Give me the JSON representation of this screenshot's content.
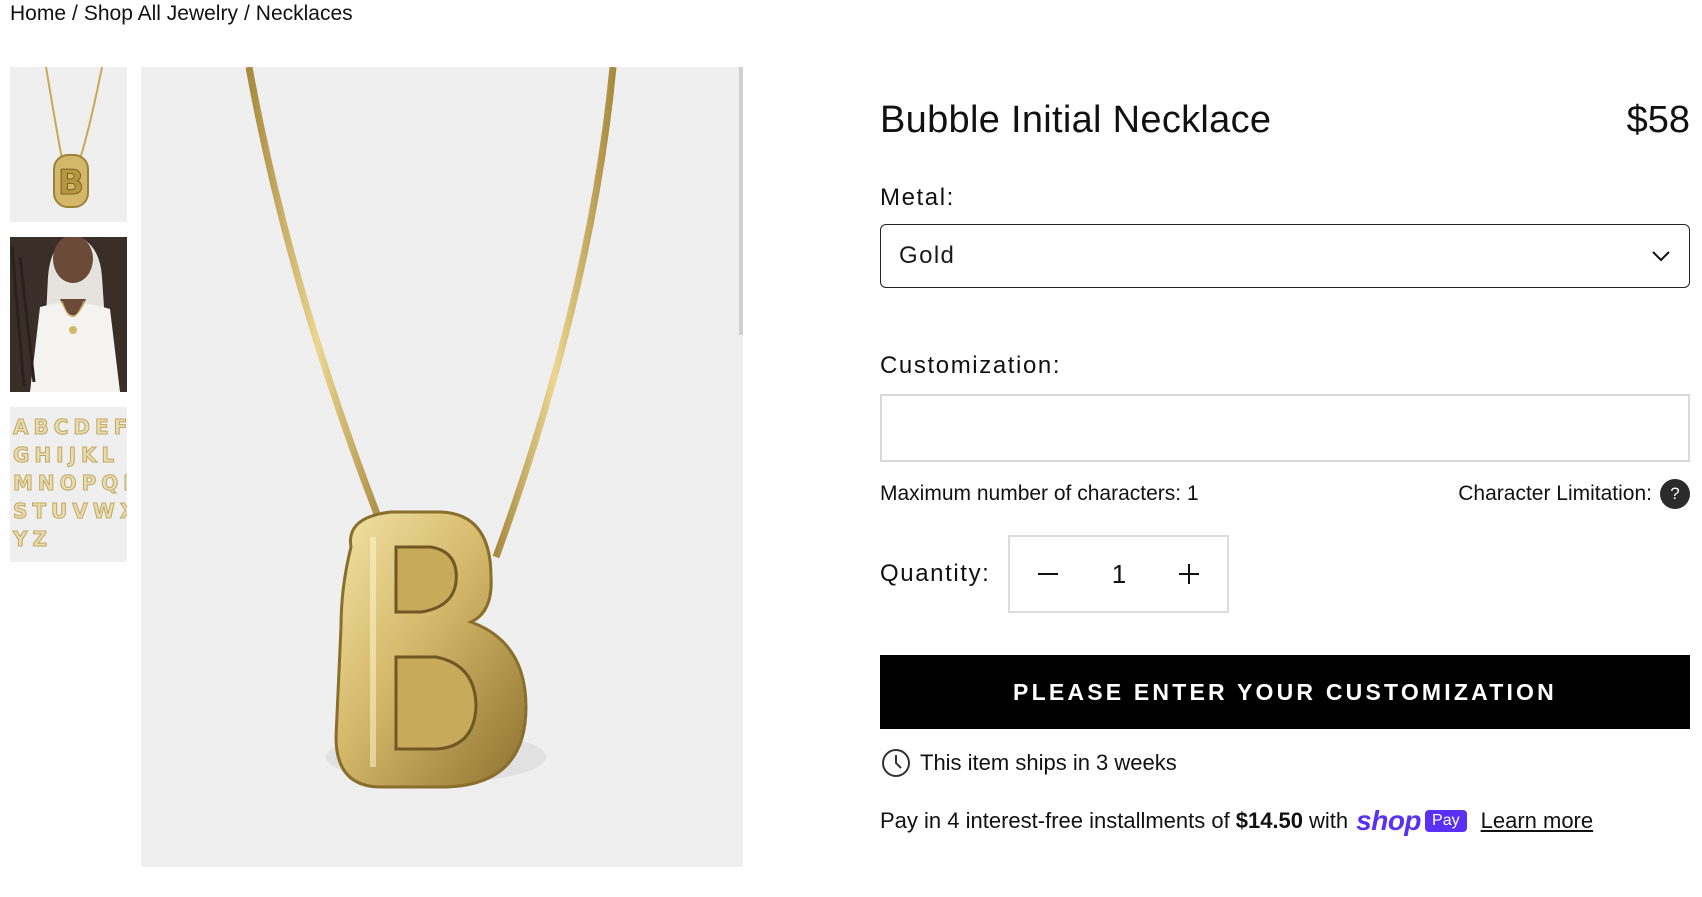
{
  "breadcrumb": {
    "home": "Home",
    "shop": "Shop All Jewelry",
    "current": "Necklaces",
    "separator": "/"
  },
  "gallery": {
    "thumbnails": [
      "necklace-thumb",
      "model-thumb",
      "alphabet-thumb"
    ],
    "alphabet_rows": [
      "ABCDEF",
      "GHIJKL",
      "MNOPQR",
      "STUVWX",
      "YZ"
    ],
    "pendant_letter": "B"
  },
  "product": {
    "title": "Bubble Initial Necklace",
    "price": "$58"
  },
  "metal": {
    "label": "Metal:",
    "selected": "Gold"
  },
  "customization": {
    "label": "Customization:",
    "value": "",
    "max_chars_text": "Maximum number of characters: 1",
    "limitation_label": "Character Limitation:",
    "help_glyph": "?"
  },
  "quantity": {
    "label": "Quantity:",
    "value": "1"
  },
  "cta": {
    "label": "PLEASE ENTER YOUR CUSTOMIZATION"
  },
  "shipping": {
    "text": "This item ships in 3 weeks"
  },
  "installments": {
    "prefix": "Pay in 4 interest-free installments of",
    "amount": "$14.50",
    "with": "with",
    "shop_word": "shop",
    "pay_badge": "Pay",
    "learn_more": "Learn more"
  },
  "colors": {
    "gold": "#d4b86a",
    "shop_purple": "#5a31f4",
    "cta_bg": "#000000"
  }
}
